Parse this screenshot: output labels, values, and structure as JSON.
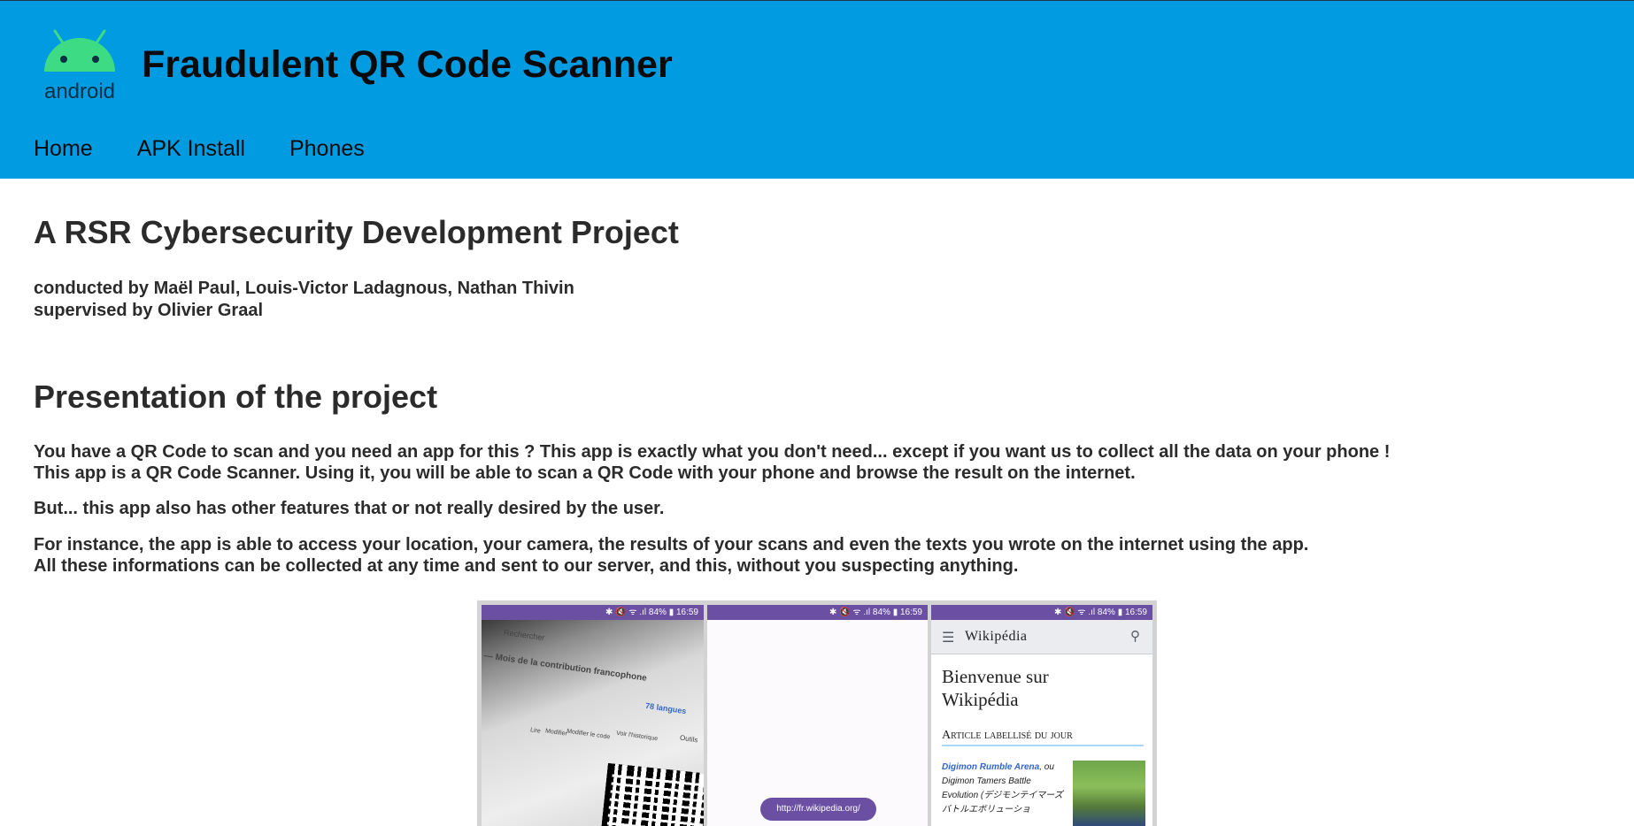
{
  "header": {
    "title": "Fraudulent QR Code Scanner",
    "logo_label": "android",
    "nav": [
      "Home",
      "APK Install",
      "Phones"
    ]
  },
  "main": {
    "project_title": "A RSR Cybersecurity Development Project",
    "conducted_by": "conducted by Maël Paul, Louis-Victor Ladagnous, Nathan Thivin",
    "supervised_by": "supervised by Olivier Graal",
    "presentation_title": "Presentation of the project",
    "paragraphs": [
      "You have a QR Code to scan and you need an app for this ? This app is exactly what you don't need... except if you want us to collect all the data on your phone !",
      "This app is a QR Code Scanner. Using it, you will be able to scan a QR Code with your phone and browse the result on the internet.",
      "But... this app also has other features that or not really desired by the user.",
      "For instance, the app is able to access your location, your camera, the results of your scans and even the texts you wrote on the internet using the app.",
      "All these informations can be collected at any time and sent to our server, and this, without you suspecting anything."
    ]
  },
  "screenshots": {
    "status_text": "✱ 🔇 ᯤ .ıl 84% ▮ 16:59",
    "phone1": {
      "texts": [
        "Rechercher",
        "— Mois de la contribution francophone",
        "78 langues",
        "Lire",
        "Modifier",
        "Modifier le code",
        "Voir l'historique",
        "Outils"
      ]
    },
    "phone2": {
      "url": "http://fr.wikipedia.org/"
    },
    "phone3": {
      "brand": "Wikipédia",
      "welcome_line1": "Bienvenue sur",
      "welcome_line2": "Wikipédia",
      "section": "Article labellisé du jour",
      "article_link": "Digimon Rumble Arena",
      "article_rest": ", ou Digimon Tamers Battle Evolution (デジモンテイマーズ バトルエボリューショ"
    }
  },
  "colors": {
    "header_bg": "#009be0",
    "android_green": "#3ddc84",
    "status_purple": "#6a4fa3"
  }
}
